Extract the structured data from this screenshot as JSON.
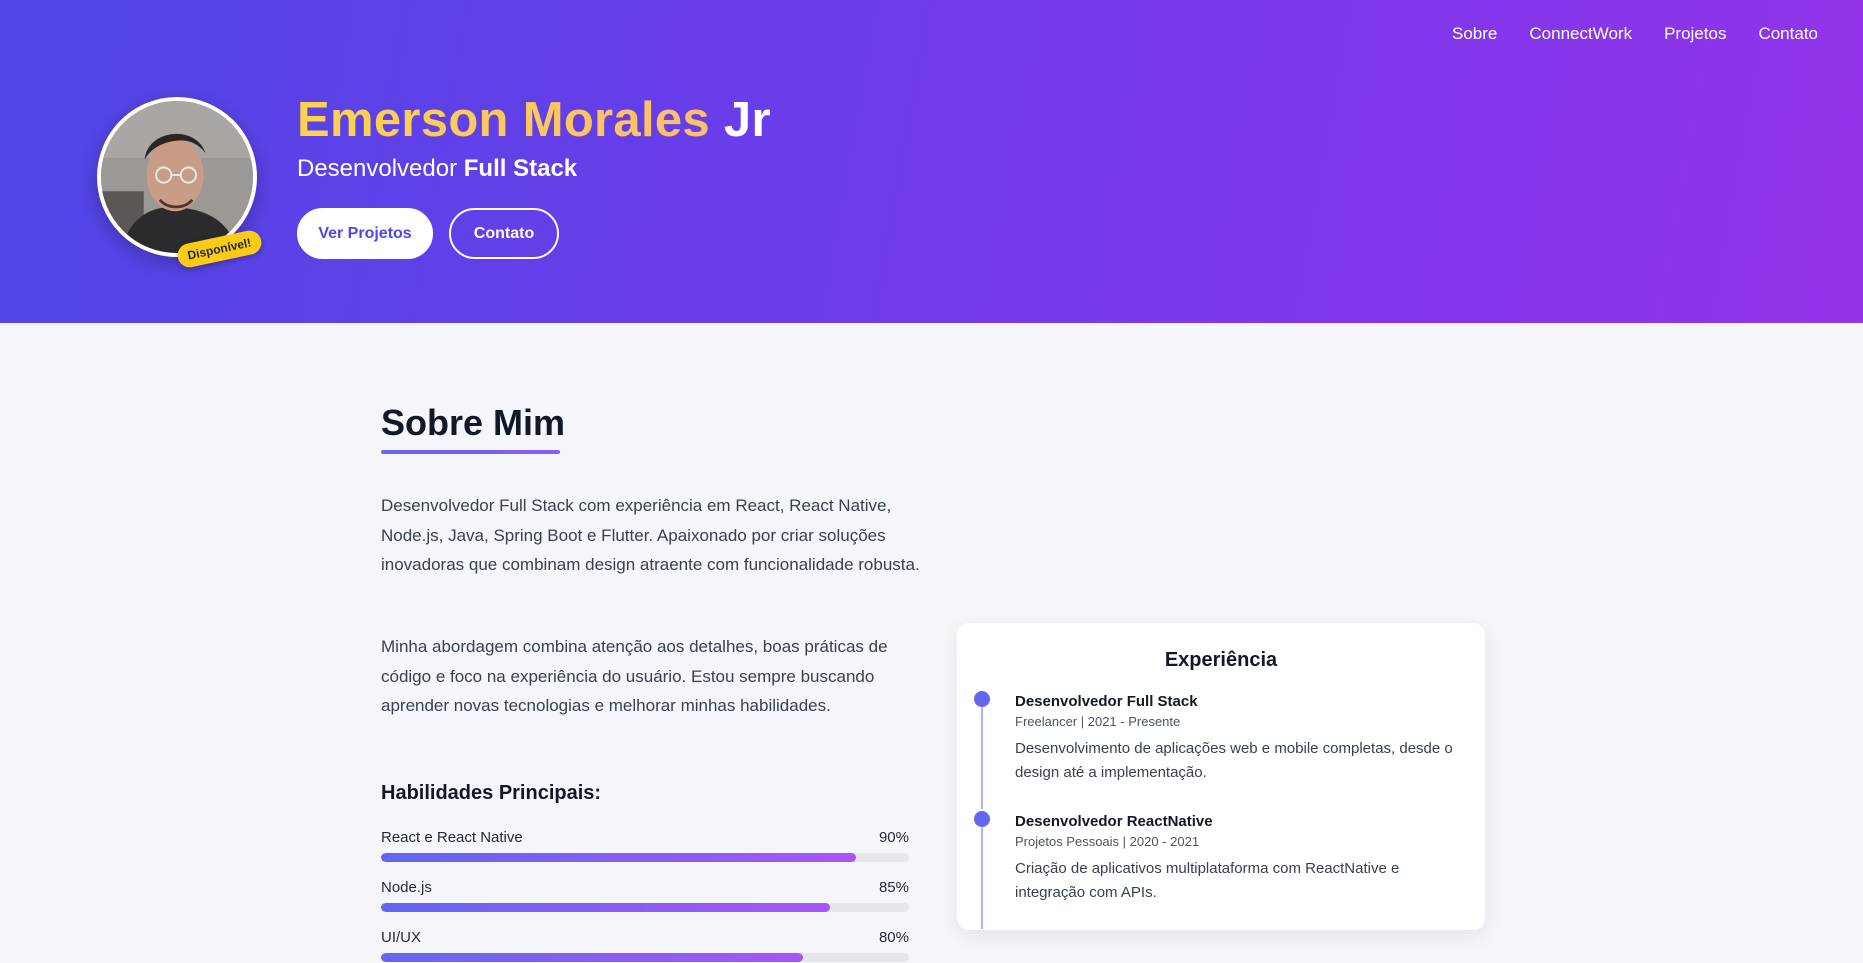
{
  "nav": {
    "items": [
      {
        "label": "Sobre"
      },
      {
        "label": "ConnectWork"
      },
      {
        "label": "Projetos"
      },
      {
        "label": "Contato"
      }
    ]
  },
  "hero": {
    "name_highlight": "Emerson Morales",
    "name_suffix": " Jr",
    "role_prefix": "Desenvolvedor ",
    "role_strong": "Full Stack",
    "badge": "Disponível!",
    "primary_button": "Ver Projetos",
    "secondary_button": "Contato"
  },
  "about": {
    "title": "Sobre Mim",
    "paragraph1": "Desenvolvedor Full Stack com experiência em React, React Native, Node.js, Java, Spring Boot e Flutter. Apaixonado por criar soluções inovadoras que combinam design atraente com funcionalidade robusta.",
    "paragraph2": "Minha abordagem combina atenção aos detalhes, boas práticas de código e foco na experiência do usuário. Estou sempre buscando aprender novas tecnologias e melhorar minhas habilidades.",
    "skills_title": "Habilidades Principais:",
    "skills": [
      {
        "label": "React e React Native",
        "percent_label": "90%",
        "value": 90
      },
      {
        "label": "Node.js",
        "percent_label": "85%",
        "value": 85
      },
      {
        "label": "UI/UX",
        "percent_label": "80%",
        "value": 80
      }
    ]
  },
  "experience": {
    "title": "Experiência",
    "items": [
      {
        "role": "Desenvolvedor Full Stack",
        "meta": "Freelancer | 2021 - Presente",
        "description": "Desenvolvimento de aplicações web e mobile completas, desde o design até a implementação."
      },
      {
        "role": "Desenvolvedor ReactNative",
        "meta": "Projetos Pessoais | 2020 - 2021",
        "description": "Criação de aplicativos multiplataforma com ReactNative e integração com APIs."
      }
    ]
  },
  "colors": {
    "hero_start": "#4f46e5",
    "hero_end": "#9333ea",
    "accent": "#6366f1",
    "badge": "#facc15",
    "name_highlight": "#fcd34d"
  }
}
